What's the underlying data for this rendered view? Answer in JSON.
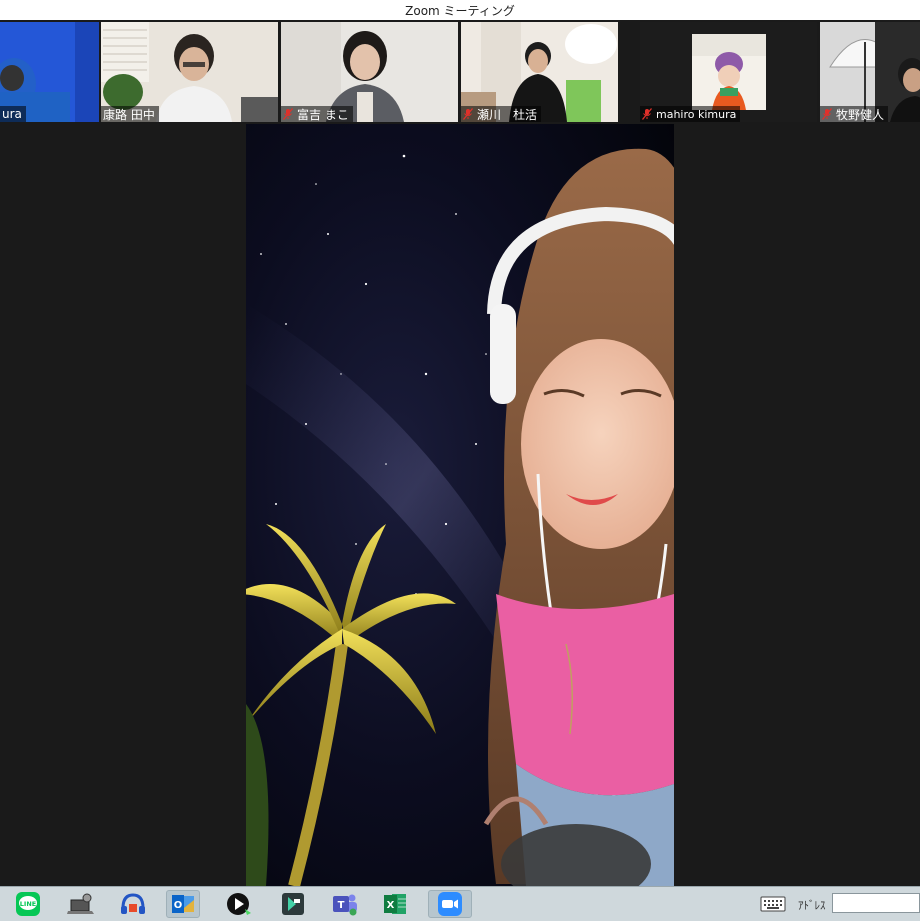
{
  "window": {
    "title": "Zoom ミーティング"
  },
  "participants": [
    {
      "name": "ura",
      "muted": false
    },
    {
      "name": "康路 田中",
      "muted": false
    },
    {
      "name": "富吉 まこ",
      "muted": true
    },
    {
      "name": "瀬川　杜活",
      "muted": true
    },
    {
      "name": "mahiro kimura",
      "muted": true
    },
    {
      "name": "牧野健人",
      "muted": true
    }
  ],
  "taskbar": {
    "apps": [
      {
        "icon": "line-icon",
        "label": "LINE"
      },
      {
        "icon": "laptop-settings-icon"
      },
      {
        "icon": "audio-headphones-icon"
      },
      {
        "icon": "outlook-icon"
      },
      {
        "icon": "media-player-icon"
      },
      {
        "icon": "filmora-icon"
      },
      {
        "icon": "teams-icon"
      },
      {
        "icon": "excel-icon"
      },
      {
        "icon": "zoom-icon"
      }
    ],
    "address_label": "ｱﾄﾞﾚｽ",
    "address_value": ""
  },
  "colors": {
    "accent_muted": "#e0302a",
    "zoom_blue": "#2d8cff",
    "line_green": "#06c755"
  }
}
